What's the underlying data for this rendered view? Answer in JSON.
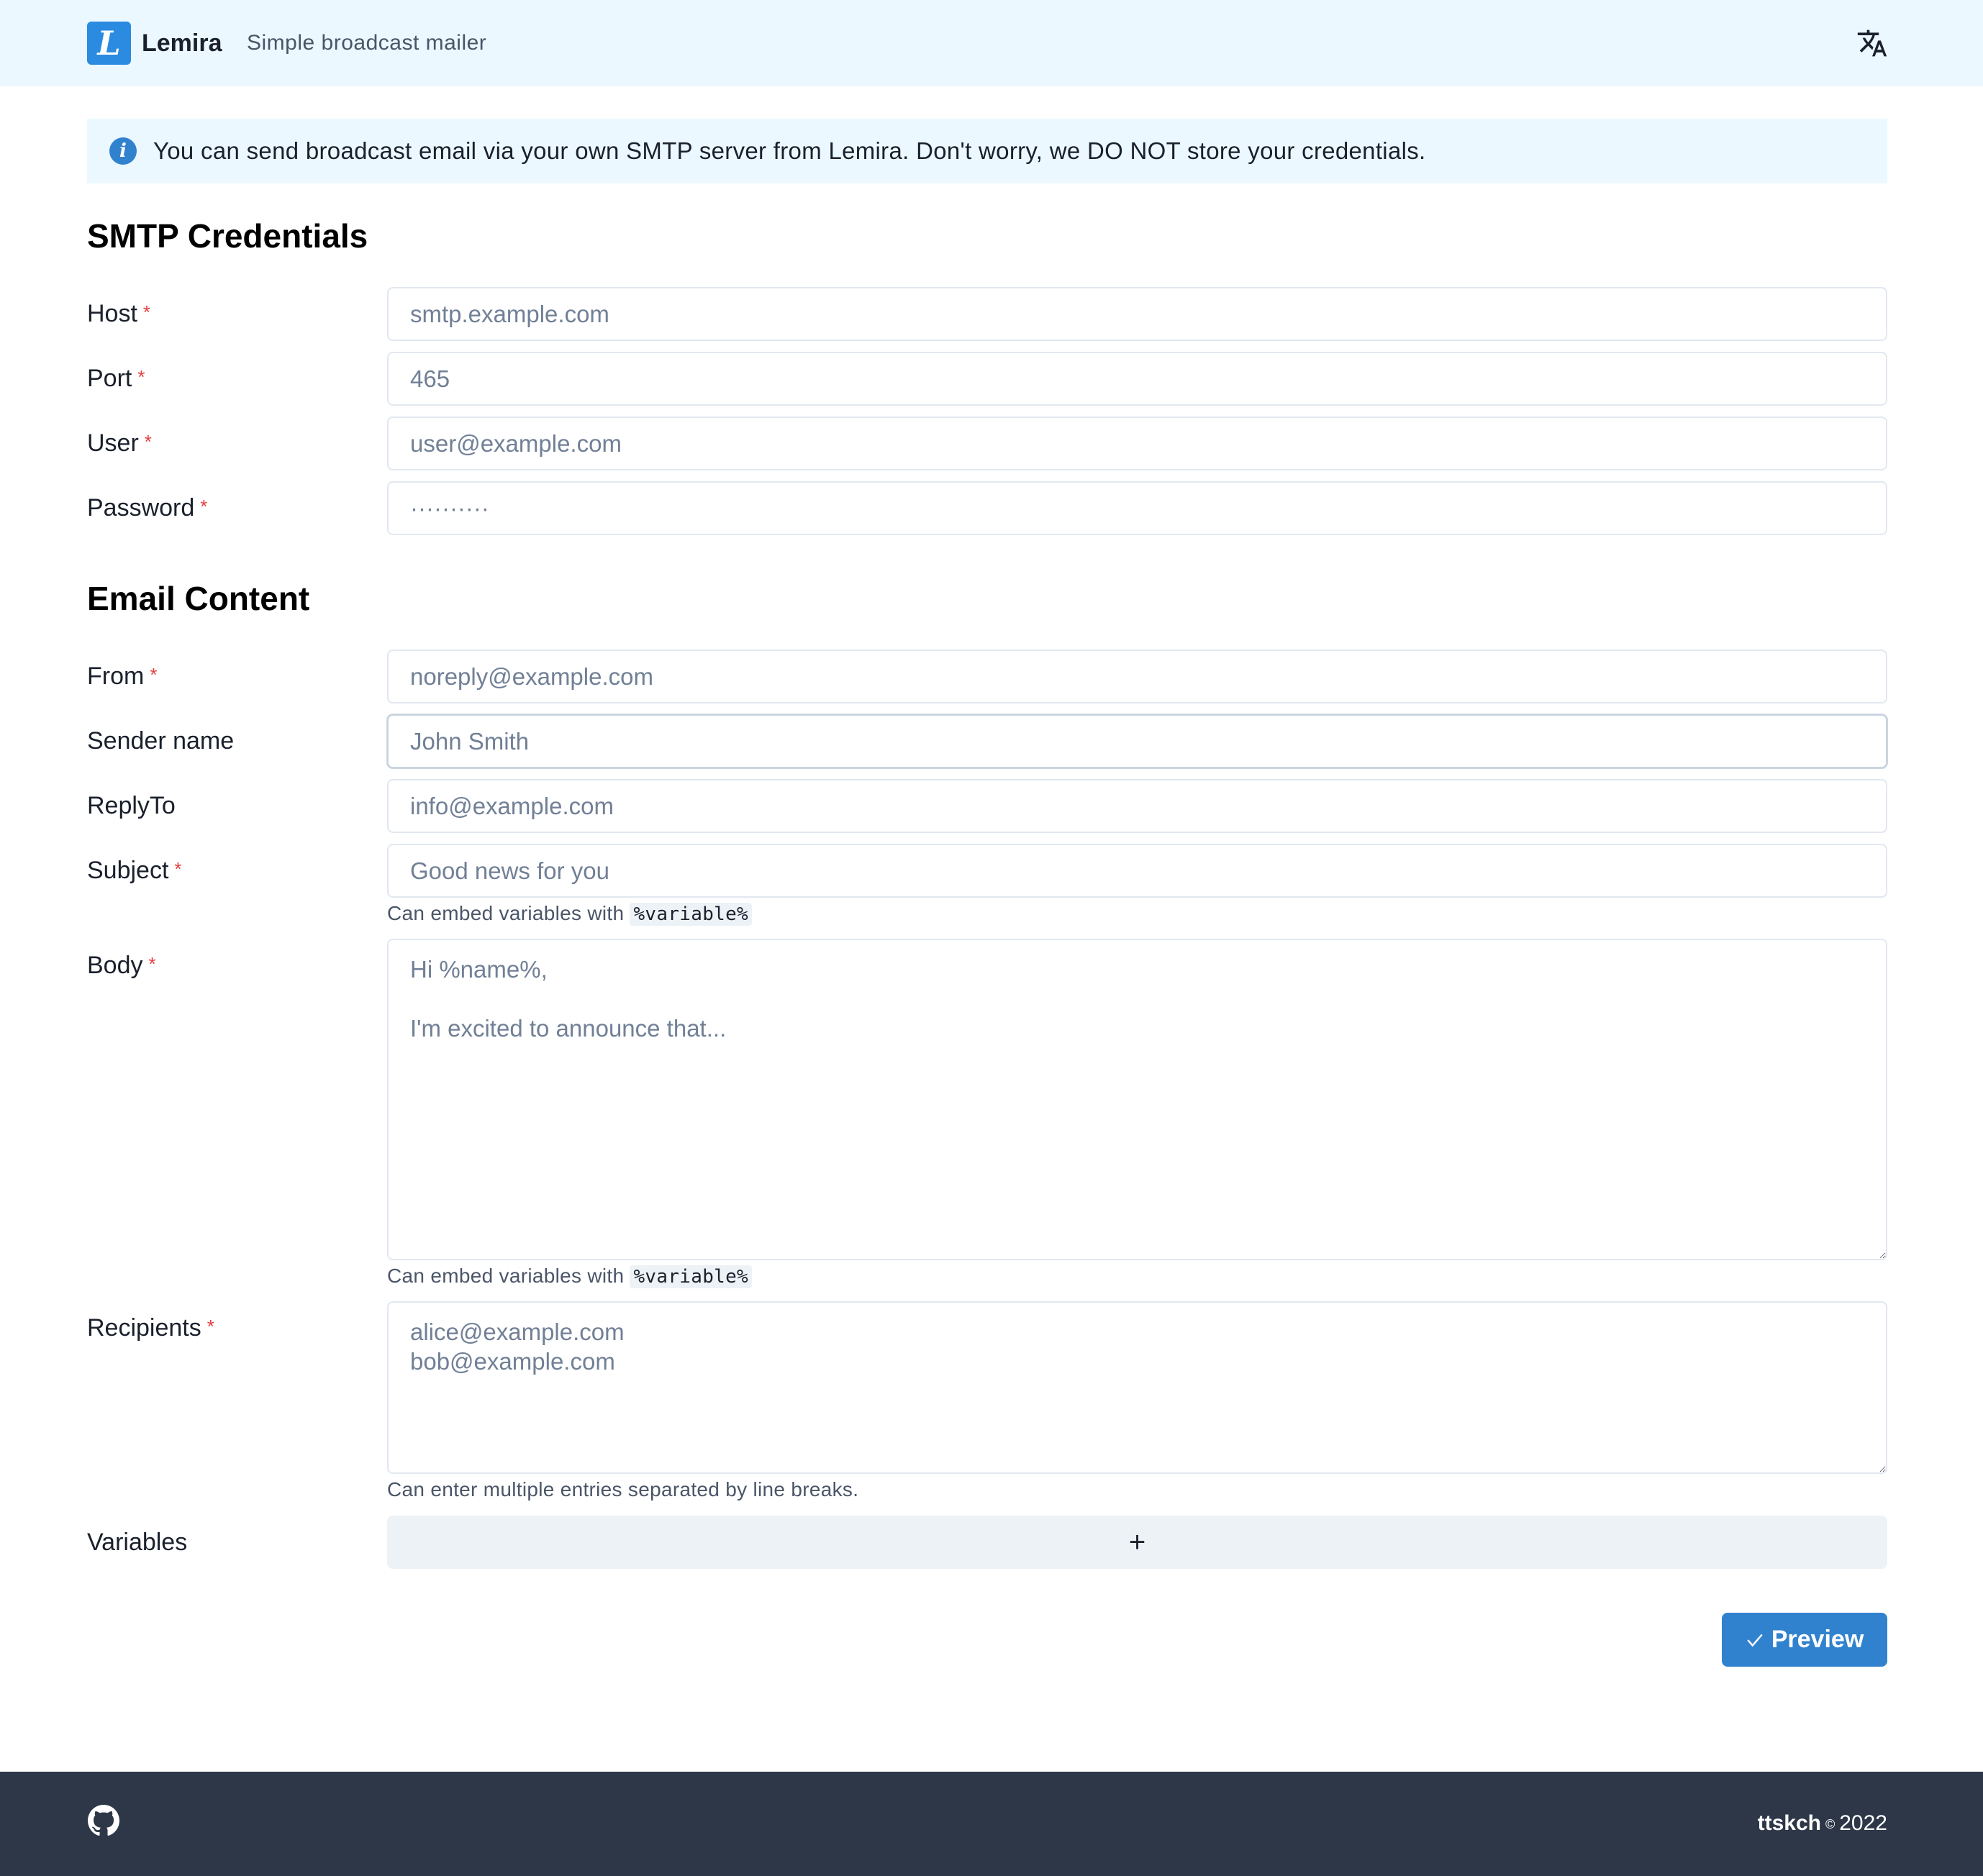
{
  "header": {
    "logo_letter": "L",
    "app_name": "Lemira",
    "tagline": "Simple broadcast mailer",
    "translate_icon": "translate-icon"
  },
  "info_banner": {
    "icon": "info-icon",
    "icon_glyph": "i",
    "text": "You can send broadcast email via your own SMTP server from Lemira. Don't worry, we DO NOT store your credentials."
  },
  "smtp": {
    "title": "SMTP Credentials",
    "host": {
      "label": "Host",
      "required": "*",
      "placeholder": "smtp.example.com"
    },
    "port": {
      "label": "Port",
      "required": "*",
      "placeholder": "465"
    },
    "user": {
      "label": "User",
      "required": "*",
      "placeholder": "user@example.com"
    },
    "password": {
      "label": "Password",
      "required": "*",
      "placeholder": "··········"
    }
  },
  "email": {
    "title": "Email Content",
    "from": {
      "label": "From",
      "required": "*",
      "placeholder": "noreply@example.com"
    },
    "sender_name": {
      "label": "Sender name",
      "placeholder": "John Smith"
    },
    "reply_to": {
      "label": "ReplyTo",
      "placeholder": "info@example.com"
    },
    "subject": {
      "label": "Subject",
      "required": "*",
      "placeholder": "Good news for you",
      "helper_prefix": "Can embed variables with",
      "helper_code": "%variable%"
    },
    "body": {
      "label": "Body",
      "required": "*",
      "placeholder": "Hi %name%,\n\nI'm excited to announce that...",
      "helper_prefix": "Can embed variables with",
      "helper_code": "%variable%"
    },
    "recipients": {
      "label": "Recipients",
      "required": "*",
      "placeholder": "alice@example.com\nbob@example.com",
      "helper": "Can enter multiple entries separated by line breaks."
    },
    "variables": {
      "label": "Variables",
      "add_symbol": "+"
    }
  },
  "actions": {
    "preview_label": "Preview",
    "preview_icon": "check-icon"
  },
  "footer": {
    "github_icon": "github-icon",
    "author": "ttskch",
    "copyright_symbol": "©",
    "year": "2022"
  },
  "colors": {
    "header_bg": "#ebf8ff",
    "brand_blue": "#2b8be0",
    "button_blue": "#3182ce",
    "required_red": "#e53e3e",
    "footer_bg": "#2d3748"
  }
}
